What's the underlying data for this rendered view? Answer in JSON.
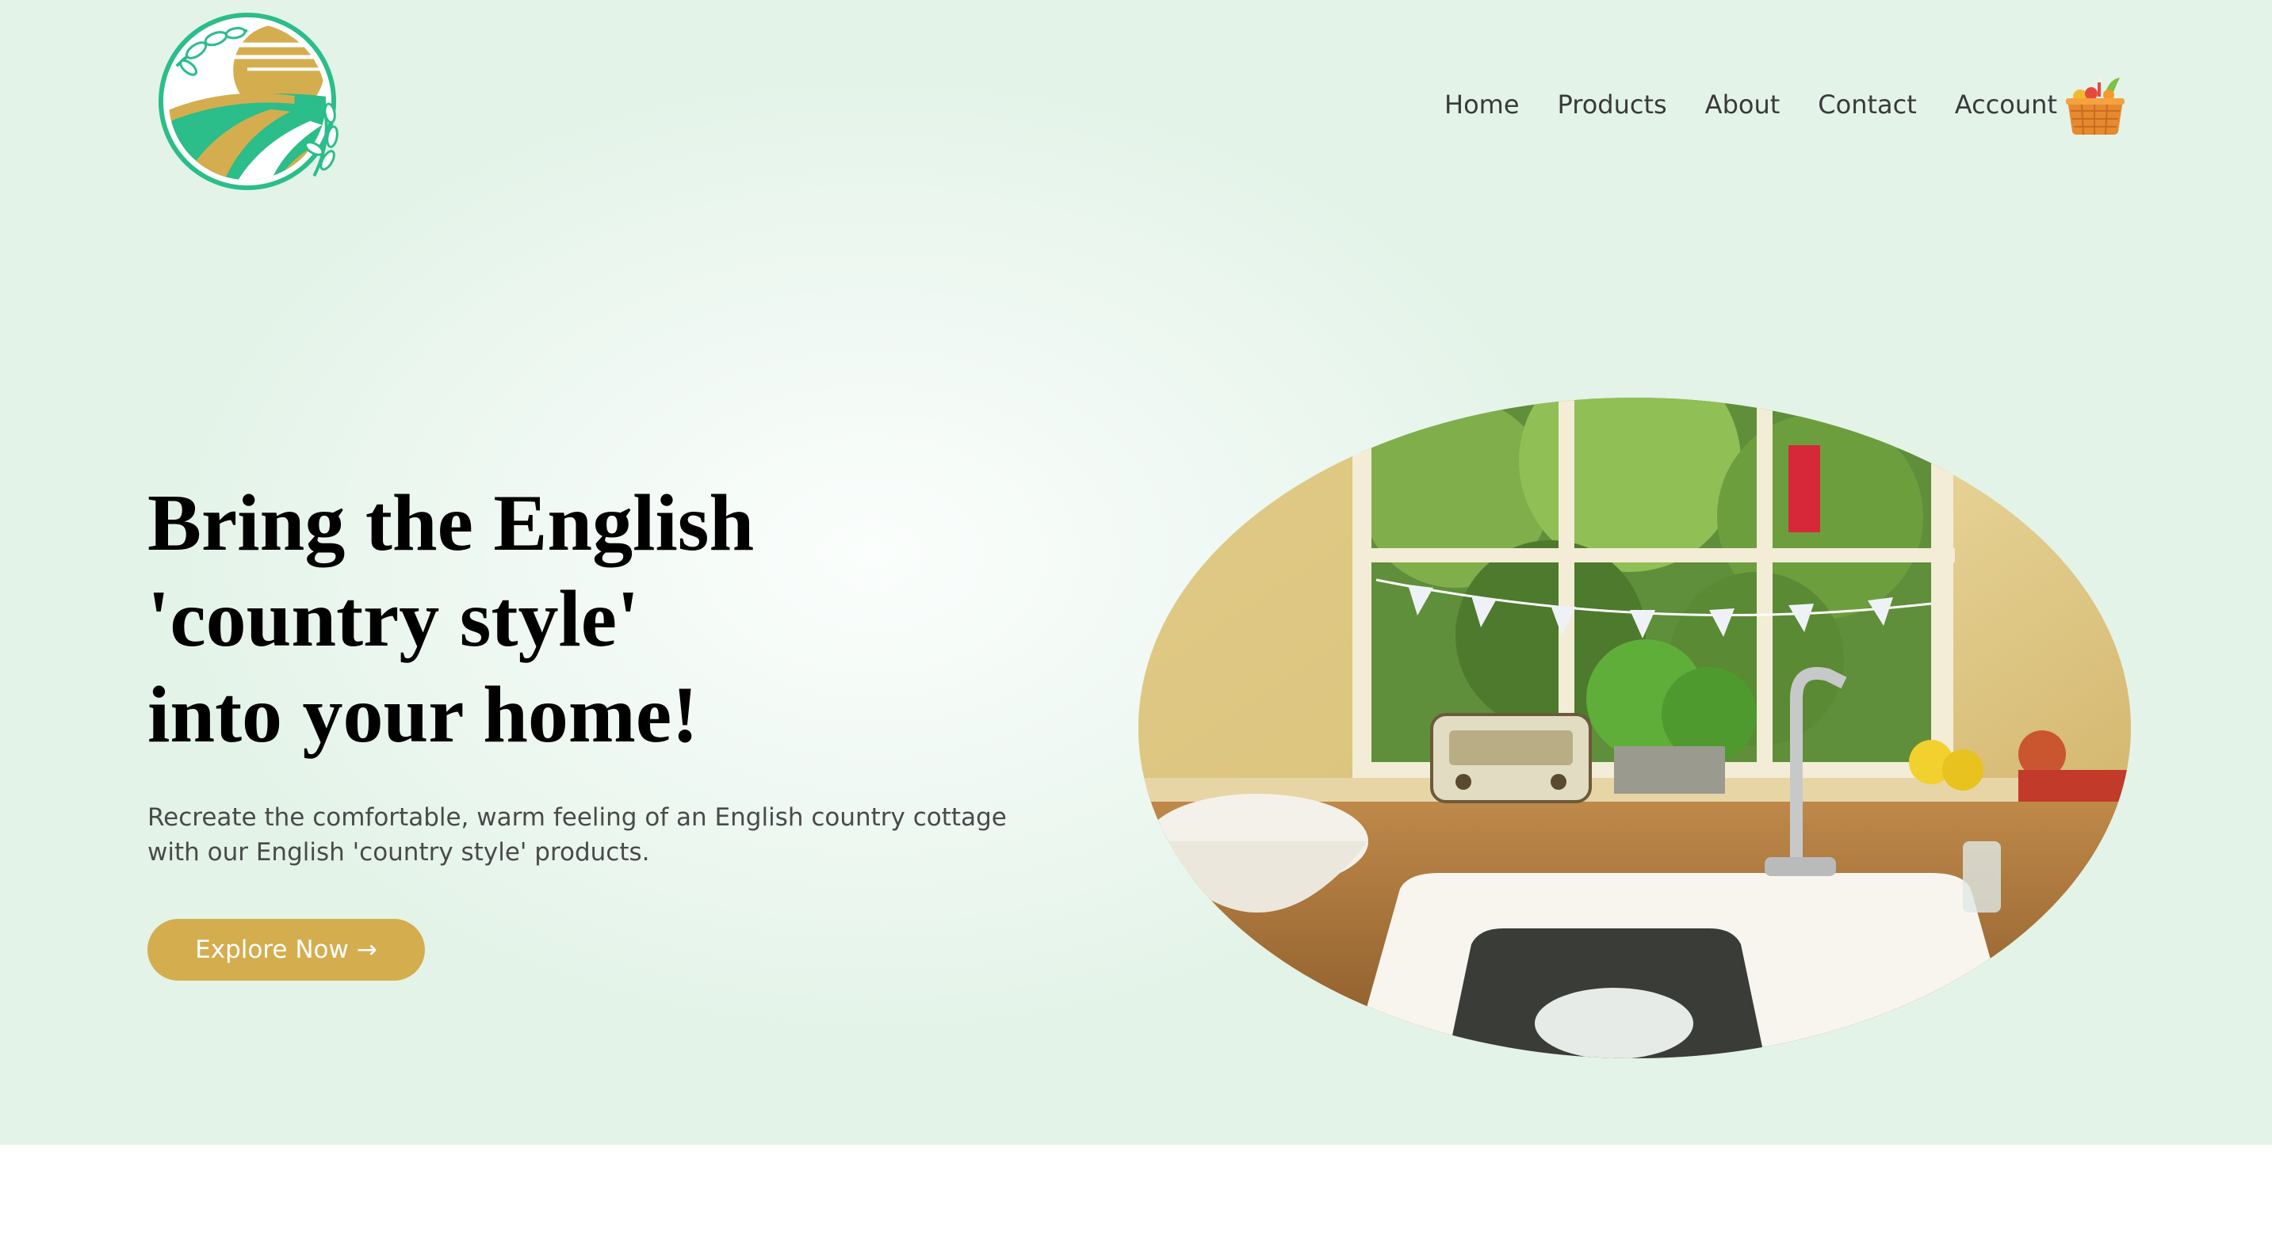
{
  "header": {
    "logo_icon": "farm-fields-sun-leaf-logo",
    "nav": [
      {
        "label": "Home"
      },
      {
        "label": "Products"
      },
      {
        "label": "About"
      },
      {
        "label": "Contact"
      },
      {
        "label": "Account"
      }
    ],
    "cart_icon": "basket-icon"
  },
  "hero": {
    "headline_lines": [
      "Bring the English",
      "'country style'",
      "into your home!"
    ],
    "subtext": "Recreate the comfortable, warm feeling of an English country cottage with our English 'country style' products.",
    "cta_label": "Explore Now",
    "cta_arrow": "→",
    "image_subject": "kitchen-sink-window-photo"
  },
  "colors": {
    "hero_background": "#e3f3e8",
    "accent_gold": "#d4ad4e",
    "logo_green": "#2bbd8a",
    "text_dark": "#000000",
    "text_muted": "#4a4a4a"
  }
}
